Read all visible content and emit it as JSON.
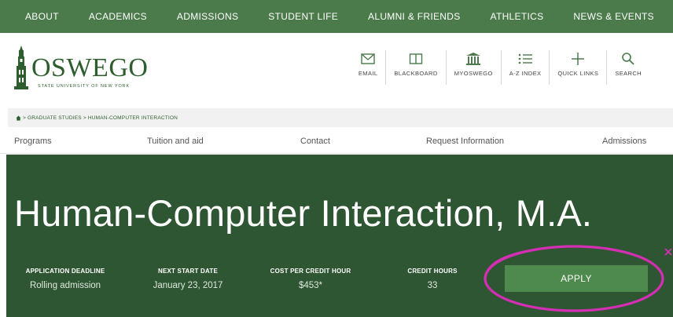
{
  "topnav": [
    "ABOUT",
    "ACADEMICS",
    "ADMISSIONS",
    "STUDENT LIFE",
    "ALUMNI & FRIENDS",
    "ATHLETICS",
    "NEWS & EVENTS"
  ],
  "logo": {
    "name": "OSWEGO",
    "subtitle": "STATE UNIVERSITY OF NEW YORK"
  },
  "tools": [
    {
      "label": "EMAIL",
      "icon": "envelope-icon"
    },
    {
      "label": "BLACKBOARD",
      "icon": "book-icon"
    },
    {
      "label": "MYOSWEGO",
      "icon": "building-icon"
    },
    {
      "label": "A-Z INDEX",
      "icon": "list-icon"
    },
    {
      "label": "QUICK LINKS",
      "icon": "plus-icon"
    },
    {
      "label": "SEARCH",
      "icon": "search-icon"
    }
  ],
  "breadcrumb": "> GRADUATE STUDIES > HUMAN-COMPUTER INTERACTION",
  "subnav": [
    "Programs",
    "Tuition and aid",
    "Contact",
    "Request Information",
    "Admissions"
  ],
  "hero": {
    "title": "Human-Computer Interaction, M.A.",
    "stats": [
      {
        "label": "APPLICATION DEADLINE",
        "value": "Rolling admission"
      },
      {
        "label": "NEXT START DATE",
        "value": "January 23, 2017"
      },
      {
        "label": "COST PER CREDIT HOUR",
        "value": "$453*"
      },
      {
        "label": "CREDIT HOURS",
        "value": "33"
      }
    ],
    "apply_label": "APPLY"
  },
  "colors": {
    "brand_green": "#4b7a4b",
    "hero_green": "#2f5632",
    "apply_green": "#4e8a4e",
    "annotation": "#d42fb4"
  }
}
